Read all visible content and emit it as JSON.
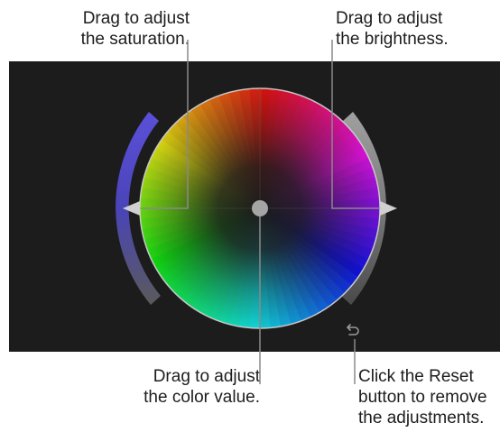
{
  "callouts": {
    "saturation": [
      "Drag to adjust",
      "the saturation."
    ],
    "brightness": [
      "Drag to adjust",
      "the brightness."
    ],
    "color_value": [
      "Drag to adjust",
      "the color value."
    ],
    "reset": [
      "Click the Reset",
      "button to remove",
      "the adjustments."
    ]
  },
  "colors": {
    "panel_bg": "#1c1c1c",
    "saturation_slider": "#5a50d8",
    "brightness_slider": "#8e8e8e",
    "leader_line": "#8a8a8a",
    "puck": "#a5a5a5"
  },
  "icons": {
    "reset": "reset-arrow-icon"
  }
}
